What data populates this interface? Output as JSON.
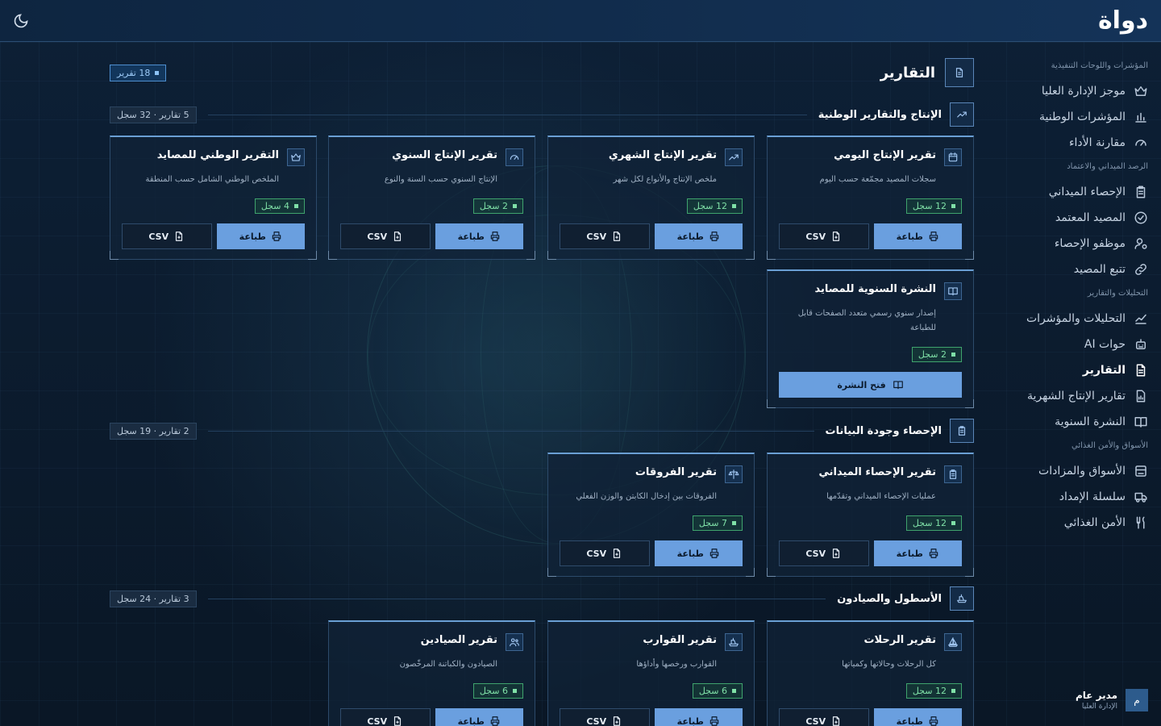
{
  "brand": {
    "logo": "دواة"
  },
  "sidebar": {
    "groups": [
      {
        "heading": "المؤشرات واللوحات التنفيذية",
        "items": [
          {
            "label": "موجز الإدارة العليا",
            "icon": "crown-icon"
          },
          {
            "label": "المؤشرات الوطنية",
            "icon": "bar-chart-icon"
          },
          {
            "label": "مقارنة الأداء",
            "icon": "gauge-icon"
          }
        ]
      },
      {
        "heading": "الرصد الميداني والاعتماد",
        "items": [
          {
            "label": "الإحصاء الميداني",
            "icon": "clipboard-icon"
          },
          {
            "label": "المصيد المعتمد",
            "icon": "check-circle-icon"
          },
          {
            "label": "موظفو الإحصاء",
            "icon": "user-gear-icon"
          },
          {
            "label": "تتبع المصيد",
            "icon": "link-icon"
          }
        ]
      },
      {
        "heading": "التحليلات والتقارير",
        "items": [
          {
            "label": "التحليلات والمؤشرات",
            "icon": "line-chart-icon"
          },
          {
            "label": "حوات AI",
            "icon": "robot-icon"
          },
          {
            "label": "التقارير",
            "icon": "document-icon",
            "active": true
          },
          {
            "label": "تقارير الإنتاج الشهرية",
            "icon": "report-chart-icon"
          },
          {
            "label": "النشرة السنوية",
            "icon": "book-icon"
          }
        ]
      },
      {
        "heading": "الأسواق والأمن الغذائي",
        "items": [
          {
            "label": "الأسواق والمزادات",
            "icon": "store-icon"
          },
          {
            "label": "سلسلة الإمداد",
            "icon": "truck-icon"
          },
          {
            "label": "الأمن الغذائي",
            "icon": "utensils-icon"
          }
        ]
      }
    ]
  },
  "user": {
    "name": "مدير عام",
    "role": "الإدارة العليا",
    "avatar": "م"
  },
  "page": {
    "title": "التقارير",
    "count_label": "18 تقرير"
  },
  "buttons": {
    "csv": "CSV",
    "print": "طباعة",
    "open_bulletin": "فتح النشرة"
  },
  "sections": [
    {
      "title": "الإنتاج والتقارير الوطنية",
      "meta": "5 تقارير · 32 سجل",
      "icon": "trend-up-icon",
      "cards": [
        {
          "title": "تقرير الإنتاج اليومي",
          "desc": "سجلات المصيد مجمّعة حسب اليوم",
          "records": "12 سجل",
          "icon": "calendar-icon"
        },
        {
          "title": "تقرير الإنتاج الشهري",
          "desc": "ملخص الإنتاج والأنواع لكل شهر",
          "records": "12 سجل",
          "icon": "trend-up-icon"
        },
        {
          "title": "تقرير الإنتاج السنوي",
          "desc": "الإنتاج السنوي حسب السنة والنوع",
          "records": "2 سجل",
          "icon": "gauge-icon"
        },
        {
          "title": "التقرير الوطني للمصايد",
          "desc": "الملخص الوطني الشامل حسب المنطقة",
          "records": "4 سجل",
          "icon": "crown-icon"
        },
        {
          "title": "النشرة السنوية للمصايد",
          "desc": "إصدار سنوي رسمي متعدد الصفحات قابل للطباعة",
          "records": "2 سجل",
          "icon": "book-icon",
          "open": true
        }
      ]
    },
    {
      "title": "الإحصاء وجودة البيانات",
      "meta": "2 تقارير · 19 سجل",
      "icon": "clipboard-icon",
      "cards": [
        {
          "title": "تقرير الإحصاء الميداني",
          "desc": "عمليات الإحصاء الميداني وتقدّمها",
          "records": "12 سجل",
          "icon": "clipboard-icon"
        },
        {
          "title": "تقرير الفروقات",
          "desc": "الفروقات بين إدخال الكابتن والوزن الفعلي",
          "records": "7 سجل",
          "icon": "scale-icon"
        }
      ]
    },
    {
      "title": "الأسطول والصيادون",
      "meta": "3 تقارير · 24 سجل",
      "icon": "boat-icon",
      "cards": [
        {
          "title": "تقرير الرحلات",
          "desc": "كل الرحلات وحالاتها وكمياتها",
          "records": "12 سجل",
          "icon": "sail-icon"
        },
        {
          "title": "تقرير القوارب",
          "desc": "القوارب ورخصها وأداؤها",
          "records": "6 سجل",
          "icon": "boat-icon"
        },
        {
          "title": "تقرير الصيادين",
          "desc": "الصيادون والكباتنة المرخّصون",
          "records": "6 سجل",
          "icon": "users-icon"
        }
      ]
    }
  ]
}
